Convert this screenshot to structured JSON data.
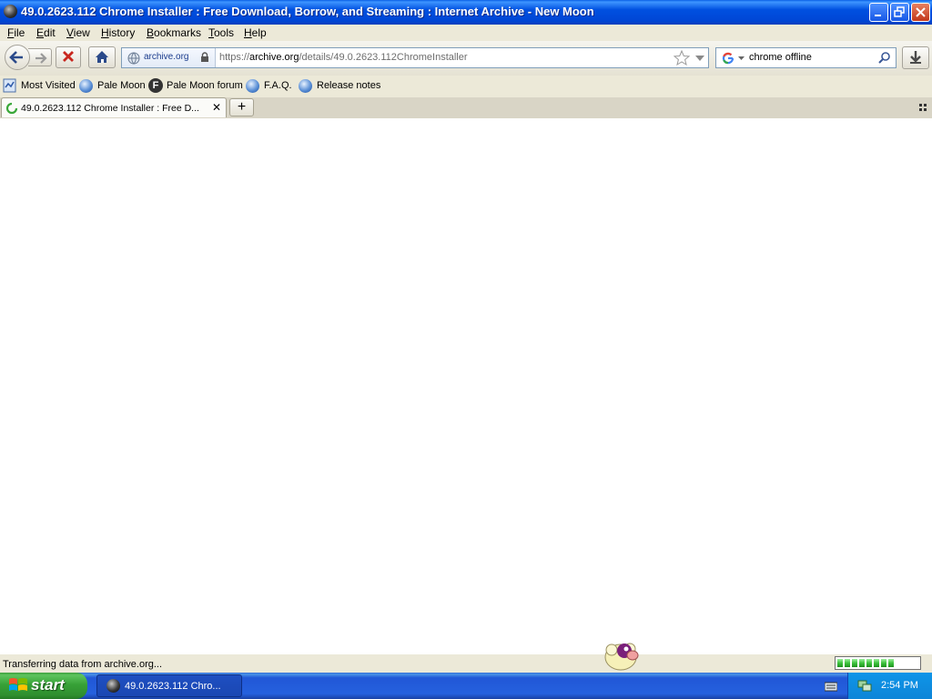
{
  "window": {
    "title": "49.0.2623.112 Chrome Installer : Free Download, Borrow, and Streaming : Internet Archive - New Moon"
  },
  "menu": {
    "items": [
      {
        "label": "File",
        "accel": "F",
        "rest": "ile"
      },
      {
        "label": "Edit",
        "accel": "E",
        "rest": "dit"
      },
      {
        "label": "View",
        "accel": "V",
        "rest": "iew"
      },
      {
        "label": "History",
        "accel": "H",
        "rest": "istory"
      },
      {
        "label": "Bookmarks",
        "accel": "B",
        "rest": "ookmarks"
      },
      {
        "label": "Tools",
        "accel": "T",
        "rest": "ools"
      },
      {
        "label": "Help",
        "accel": "H",
        "rest": "elp"
      }
    ]
  },
  "navbar": {
    "identity": "archive.org",
    "url_prefix": "https://",
    "url_domain": "archive.org",
    "url_path": "/details/49.0.2623.112ChromeInstaller",
    "search_value": "chrome offline"
  },
  "bookmarks": {
    "items": [
      "Most Visited",
      "Pale Moon",
      "Pale Moon forum",
      "F.A.Q.",
      "Release notes"
    ]
  },
  "tabs": {
    "active_label": "49.0.2623.112 Chrome Installer : Free D...",
    "close_glyph": "✕",
    "new_tab_glyph": "+"
  },
  "status": {
    "text": "Transferring data from archive.org...",
    "progress_fraction": 0.78
  },
  "taskbar": {
    "start_label": "start",
    "task_label": "49.0.2623.112 Chro...",
    "clock": "2:54 PM"
  },
  "colors": {
    "titlebar": "#0050e0",
    "taskbar": "#2561de",
    "start_green": "#37a137",
    "progress_green": "#3cc23c"
  }
}
